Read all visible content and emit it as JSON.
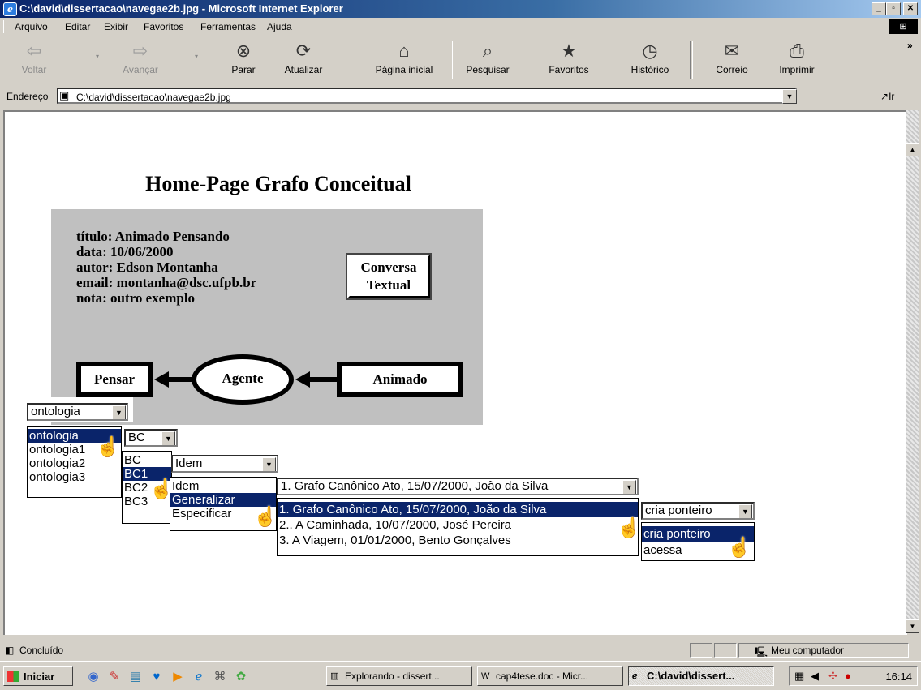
{
  "window": {
    "title": "C:\\david\\dissertacao\\navegae2b.jpg - Microsoft Internet Explorer"
  },
  "menu": [
    "Arquivo",
    "Editar",
    "Exibir",
    "Favoritos",
    "Ferramentas",
    "Ajuda"
  ],
  "toolbar": {
    "back": "Voltar",
    "forward": "Avançar",
    "stop": "Parar",
    "refresh": "Atualizar",
    "home": "Página inicial",
    "search": "Pesquisar",
    "favorites": "Favoritos",
    "history": "Histórico",
    "mail": "Correio",
    "print": "Imprimir"
  },
  "address": {
    "label": "Endereço",
    "value": "C:\\david\\dissertacao\\navegae2b.jpg",
    "go": "Ir"
  },
  "page": {
    "heading": "Home-Page Grafo Conceitual",
    "meta": {
      "titulo": "título: Animado Pensando",
      "data": "data: 10/06/2000",
      "autor": "autor: Edson Montanha",
      "email": "email: montanha@dsc.ufpb.br",
      "nota": "nota: outro exemplo"
    },
    "conversa_button": [
      "Conversa",
      "Textual"
    ],
    "graph": {
      "left": "Pensar",
      "center": "Agente",
      "right": "Animado"
    },
    "ontologia_select": {
      "value": "ontologia",
      "options": [
        "ontologia",
        "ontologia1",
        "ontologia2",
        "ontologia3"
      ],
      "highlighted": 0
    },
    "bc_select": {
      "value": "BC",
      "options": [
        "BC",
        "BC1",
        "BC2",
        "BC3"
      ],
      "highlighted": 1
    },
    "rel_select": {
      "value": "Idem",
      "options": [
        "Idem",
        "Generalizar",
        "Especificar"
      ],
      "highlighted": 1
    },
    "grafo_select": {
      "value": "1. Grafo Canônico Ato, 15/07/2000, João da Silva",
      "options": [
        "1. Grafo Canônico Ato, 15/07/2000, João da Silva",
        "2.. A Caminhada, 10/07/2000, José Pereira",
        "3. A Viagem, 01/01/2000, Bento Gonçalves"
      ],
      "highlighted": 0
    },
    "action_select": {
      "value": "cria ponteiro",
      "options": [
        "cria ponteiro",
        "acessa"
      ],
      "highlighted": 0
    }
  },
  "status": {
    "text": "Concluído",
    "zone": "Meu computador"
  },
  "taskbar": {
    "start": "Iniciar",
    "tasks": [
      "Explorando - dissert...",
      "cap4tese.doc - Micr...",
      "C:\\david\\dissert..."
    ],
    "clock": "16:14"
  }
}
